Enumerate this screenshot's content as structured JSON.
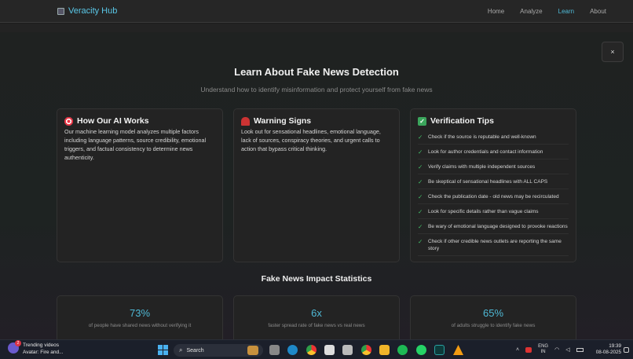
{
  "nav": {
    "brand": "Veracity Hub",
    "links": [
      "Home",
      "Analyze",
      "Learn",
      "About"
    ],
    "active": "Learn"
  },
  "modal": {
    "close_label": "×",
    "title": "Learn About Fake News Detection",
    "subtitle": "Understand how to identify misinformation and protect yourself from fake news",
    "cards": [
      {
        "icon": "target-icon",
        "heading": "How Our AI Works",
        "body": "Our machine learning model analyzes multiple factors including language patterns, source credibility, emotional triggers, and factual consistency to determine news authenticity."
      },
      {
        "icon": "alarm-icon",
        "heading": "Warning Signs",
        "body": "Look out for sensational headlines, emotional language, lack of sources, conspiracy theories, and urgent calls to action that bypass critical thinking."
      },
      {
        "icon": "check-icon",
        "heading": "Verification Tips",
        "tips": [
          "Check if the source is reputable and well-known",
          "Look for author credentials and contact information",
          "Verify claims with multiple independent sources",
          "Be skeptical of sensational headlines with ALL CAPS",
          "Check the publication date - old news may be recirculated",
          "Look for specific details rather than vague claims",
          "Be wary of emotional language designed to provoke reactions",
          "Check if other credible news outlets are reporting the same story"
        ]
      }
    ],
    "stats_title": "Fake News Impact Statistics",
    "stats": [
      {
        "value": "73%",
        "label": "of people have shared news without verifying it"
      },
      {
        "value": "6x",
        "label": "faster spread rate of fake news vs real news"
      },
      {
        "value": "65%",
        "label": "of adults struggle to identify fake news"
      }
    ]
  },
  "taskbar": {
    "widget_badge": "2",
    "widget_title": "Trending videos",
    "widget_sub": "Avatar: Fire and...",
    "search_placeholder": "Search",
    "lang_top": "ENG",
    "lang_bottom": "IN",
    "time": "19:39",
    "date": "08-08-2025"
  },
  "colors": {
    "accent": "#4fb9d6",
    "check": "#43c06a"
  }
}
